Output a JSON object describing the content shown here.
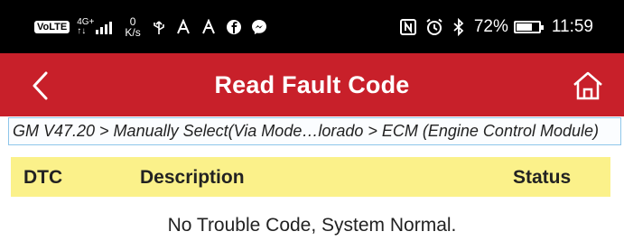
{
  "status_bar": {
    "volte": "VoLTE",
    "network_type": "4G+",
    "network_sub": "↑↓",
    "speed_value": "0",
    "speed_unit": "K/s",
    "battery_percent": "72%",
    "battery_level": 0.72,
    "time": "11:59",
    "icons": [
      "usb-icon",
      "location-icon",
      "location-icon",
      "facebook-icon",
      "messenger-icon",
      "nfc-icon",
      "alarm-icon",
      "bluetooth-icon"
    ]
  },
  "app_bar": {
    "title": "Read Fault Code",
    "back_icon": "chevron-left-icon",
    "home_icon": "home-icon",
    "background": "#c8202a"
  },
  "breadcrumb": "GM V47.20 > Manually Select(Via Mode…lorado > ECM (Engine Control Module)",
  "table": {
    "headers": {
      "dtc": "DTC",
      "description": "Description",
      "status": "Status"
    },
    "header_background": "#fbf18a"
  },
  "message": "No Trouble Code, System Normal."
}
